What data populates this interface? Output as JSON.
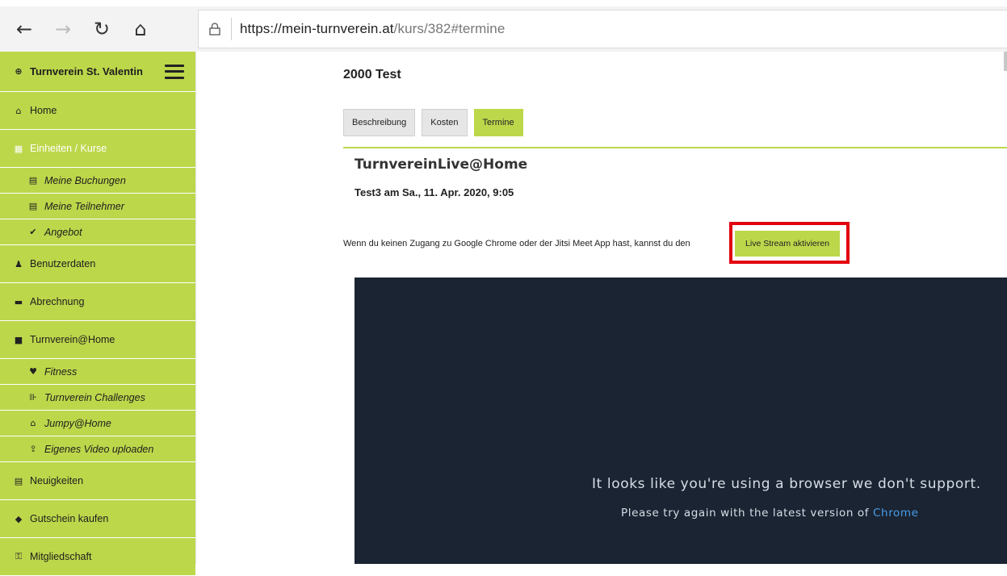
{
  "browser": {
    "back_icon": "←",
    "forward_icon": "→",
    "refresh_icon": "↻",
    "home_icon": "⌂",
    "url_host": "https://mein-turnverein.at",
    "url_path": "/kurs/382#termine"
  },
  "sidebar": {
    "brand": "Turnverein St. Valentin",
    "items": [
      {
        "label": "Home",
        "icon": "home-icon",
        "glyph": "⌂"
      },
      {
        "label": "Einheiten / Kurse",
        "icon": "grid-icon",
        "glyph": "▦"
      },
      {
        "label": "Meine Buchungen",
        "icon": "list-icon",
        "glyph": "▤"
      },
      {
        "label": "Meine Teilnehmer",
        "icon": "list-icon",
        "glyph": "▤"
      },
      {
        "label": "Angebot",
        "icon": "check-icon",
        "glyph": "✔"
      },
      {
        "label": "Benutzerdaten",
        "icon": "users-icon",
        "glyph": "♟"
      },
      {
        "label": "Abrechnung",
        "icon": "money-icon",
        "glyph": "▬"
      },
      {
        "label": "Turnverein@Home",
        "icon": "video-icon",
        "glyph": "■"
      },
      {
        "label": "Fitness",
        "icon": "heart-icon",
        "glyph": "♥"
      },
      {
        "label": "Turnverein Challenges",
        "icon": "dumbbell-icon",
        "glyph": "⊪"
      },
      {
        "label": "Jumpy@Home",
        "icon": "home-icon",
        "glyph": "⌂"
      },
      {
        "label": "Eigenes Video uploaden",
        "icon": "upload-icon",
        "glyph": "⇪"
      },
      {
        "label": "Neuigkeiten",
        "icon": "newspaper-icon",
        "glyph": "▤"
      },
      {
        "label": "Gutschein kaufen",
        "icon": "tag-icon",
        "glyph": "◆"
      },
      {
        "label": "Mitgliedschaft",
        "icon": "unlock-icon",
        "glyph": "⚿"
      }
    ]
  },
  "main": {
    "title": "2000 Test",
    "tabs": [
      "Beschreibung",
      "Kosten",
      "Termine"
    ],
    "section_title": "TurnvereinLive@Home",
    "session": "Test3 am Sa., 11. Apr. 2020, 9:05",
    "note": "Wenn du keinen Zugang zu Google Chrome oder der Jitsi Meet App hast, kannst du den",
    "live_button": "Live Stream aktivieren",
    "video_message": "It looks like you're using a browser we don't support.",
    "video_retry": "Please try again with the latest version of",
    "video_link": "Chrome"
  }
}
